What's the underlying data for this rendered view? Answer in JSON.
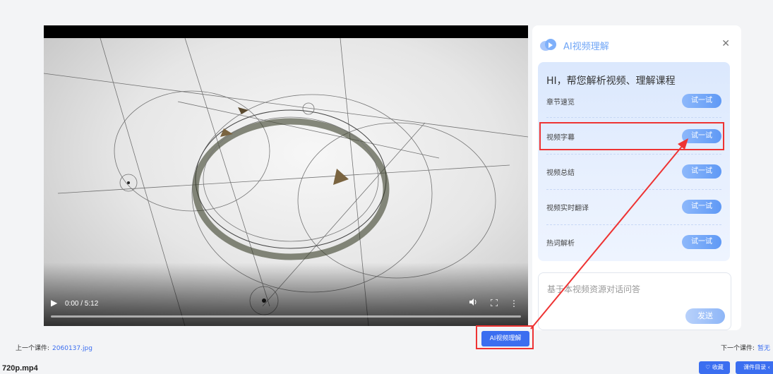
{
  "video": {
    "time": "0:00 / 5:12",
    "progress": 0.0
  },
  "ai_panel": {
    "title": "AI视频理解",
    "close_icon": "close-icon",
    "greeting": "HI，帮您解析视频、理解课程",
    "features": [
      {
        "label": "章节速览",
        "button": "试一试"
      },
      {
        "label": "视频字幕",
        "button": "试一试"
      },
      {
        "label": "视频总结",
        "button": "试一试"
      },
      {
        "label": "视频实时翻译",
        "button": "试一试"
      },
      {
        "label": "热词解析",
        "button": "试一试"
      }
    ],
    "qa": {
      "placeholder": "基于本视频资源对话问答",
      "send": "发送"
    }
  },
  "ai_video_button": "AI视频理解",
  "nav": {
    "prev_label": "上一个课件:",
    "prev_link": "2060137.jpg",
    "next_label": "下一个课件:",
    "next_link": "暂无"
  },
  "file_name": "720p.mp4",
  "actions": {
    "favorite": "♡ 收藏",
    "catalog": "课件目录 ‹"
  },
  "colors": {
    "accent": "#3b6ef0",
    "highlight": "#e33333",
    "ai_title": "#6fa5f6"
  }
}
